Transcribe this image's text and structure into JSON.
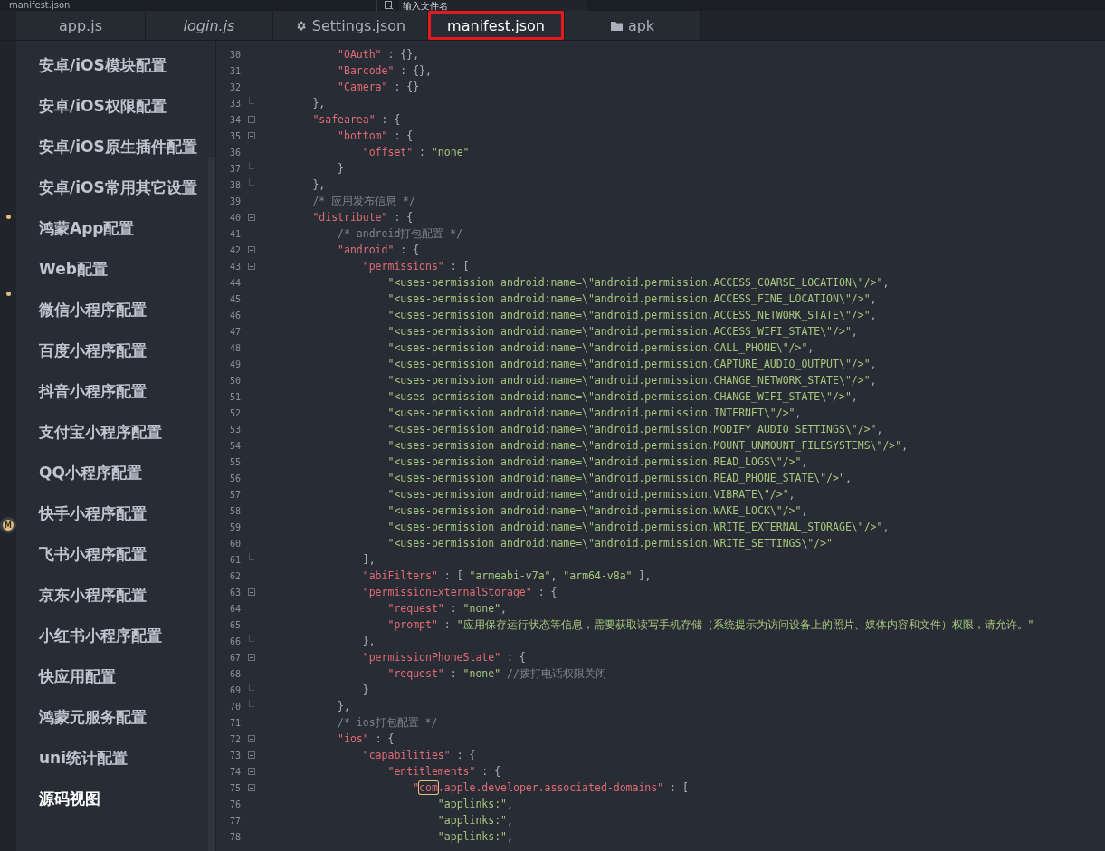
{
  "top_strip": {
    "title": "manifest.json",
    "search": {
      "placeholder": "输入文件名"
    }
  },
  "tabs": [
    {
      "label": "app.js",
      "kind": "file",
      "selected": false,
      "italic": false
    },
    {
      "label": "login.js",
      "kind": "file",
      "selected": false,
      "italic": true
    },
    {
      "label": "Settings.json",
      "kind": "settings",
      "selected": false,
      "italic": false
    },
    {
      "label": "manifest.json",
      "kind": "file",
      "selected": true,
      "italic": false,
      "framed": true
    },
    {
      "label": "apk",
      "kind": "folder",
      "selected": false,
      "italic": false
    }
  ],
  "gutter_markers": [
    {
      "kind": "dot"
    },
    {
      "kind": "dot"
    },
    {
      "kind": "badge",
      "text": "M"
    }
  ],
  "sidebar": {
    "items": [
      {
        "label": "安卓/iOS模块配置",
        "selected": false
      },
      {
        "label": "安卓/iOS权限配置",
        "selected": false
      },
      {
        "label": "安卓/iOS原生插件配置",
        "selected": false
      },
      {
        "label": "安卓/iOS常用其它设置",
        "selected": false
      },
      {
        "label": "鸿蒙App配置",
        "selected": false
      },
      {
        "label": "Web配置",
        "selected": false
      },
      {
        "label": "微信小程序配置",
        "selected": false
      },
      {
        "label": "百度小程序配置",
        "selected": false
      },
      {
        "label": "抖音小程序配置",
        "selected": false
      },
      {
        "label": "支付宝小程序配置",
        "selected": false
      },
      {
        "label": "QQ小程序配置",
        "selected": false
      },
      {
        "label": "快手小程序配置",
        "selected": false
      },
      {
        "label": "飞书小程序配置",
        "selected": false
      },
      {
        "label": "京东小程序配置",
        "selected": false
      },
      {
        "label": "小红书小程序配置",
        "selected": false
      },
      {
        "label": "快应用配置",
        "selected": false
      },
      {
        "label": "鸿蒙元服务配置",
        "selected": false
      },
      {
        "label": "uni统计配置",
        "selected": false
      },
      {
        "label": "源码视图",
        "selected": true
      }
    ]
  },
  "editor": {
    "lines": [
      {
        "n": "30",
        "kind": "plain",
        "tokens": [
          {
            "kind": "key",
            "t": "\"OAuth\""
          },
          {
            "kind": "punct",
            "t": " : {},"
          }
        ]
      },
      {
        "n": "31",
        "kind": "plain",
        "tokens": [
          {
            "kind": "key",
            "t": "\"Barcode\""
          },
          {
            "kind": "punct",
            "t": " : {},"
          }
        ]
      },
      {
        "n": "32",
        "kind": "plain",
        "tokens": [
          {
            "kind": "key",
            "t": "\"Camera\""
          },
          {
            "kind": "punct",
            "t": " : {}"
          }
        ]
      },
      {
        "n": "33",
        "kind": "closer",
        "tokens": [
          {
            "kind": "punct",
            "t": "},"
          }
        ]
      },
      {
        "n": "34",
        "kind": "opener",
        "tokens": [
          {
            "kind": "key",
            "t": "\"safearea\""
          },
          {
            "kind": "punct",
            "t": " : {"
          }
        ]
      },
      {
        "n": "35",
        "kind": "opener",
        "tokens": [
          {
            "kind": "key",
            "t": "\"bottom\""
          },
          {
            "kind": "punct",
            "t": " : {"
          }
        ]
      },
      {
        "n": "36",
        "kind": "plain",
        "tokens": [
          {
            "kind": "key",
            "t": "\"offset\""
          },
          {
            "kind": "punct",
            "t": " : "
          },
          {
            "kind": "string",
            "t": "\"none\""
          }
        ]
      },
      {
        "n": "37",
        "kind": "closer",
        "tokens": [
          {
            "kind": "punct",
            "t": "}"
          }
        ]
      },
      {
        "n": "38",
        "kind": "closer",
        "tokens": [
          {
            "kind": "punct",
            "t": "},"
          }
        ]
      },
      {
        "n": "39",
        "kind": "plain",
        "tokens": [
          {
            "kind": "comment",
            "t": "/* 应用发布信息 */"
          }
        ]
      },
      {
        "n": "40",
        "kind": "opener",
        "tokens": [
          {
            "kind": "key",
            "t": "\"distribute\""
          },
          {
            "kind": "punct",
            "t": " : {"
          }
        ]
      },
      {
        "n": "41",
        "kind": "plain",
        "tokens": [
          {
            "kind": "comment",
            "t": "/* android打包配置 */"
          }
        ]
      },
      {
        "n": "42",
        "kind": "opener",
        "tokens": [
          {
            "kind": "key",
            "t": "\"android\""
          },
          {
            "kind": "punct",
            "t": " : {"
          }
        ]
      },
      {
        "n": "43",
        "kind": "opener",
        "tokens": [
          {
            "kind": "key",
            "t": "\"permissions\""
          },
          {
            "kind": "punct",
            "t": " : ["
          }
        ]
      },
      {
        "n": "44",
        "kind": "plain",
        "tokens": [
          {
            "kind": "string",
            "t": "\"<uses-permission android:name=\\\"android.permission.ACCESS_COARSE_LOCATION\\\"/>\""
          },
          {
            "kind": "punct",
            "t": ","
          }
        ]
      },
      {
        "n": "45",
        "kind": "plain",
        "tokens": [
          {
            "kind": "string",
            "t": "\"<uses-permission android:name=\\\"android.permission.ACCESS_FINE_LOCATION\\\"/>\""
          },
          {
            "kind": "punct",
            "t": ","
          }
        ]
      },
      {
        "n": "46",
        "kind": "plain",
        "tokens": [
          {
            "kind": "string",
            "t": "\"<uses-permission android:name=\\\"android.permission.ACCESS_NETWORK_STATE\\\"/>\""
          },
          {
            "kind": "punct",
            "t": ","
          }
        ]
      },
      {
        "n": "47",
        "kind": "plain",
        "tokens": [
          {
            "kind": "string",
            "t": "\"<uses-permission android:name=\\\"android.permission.ACCESS_WIFI_STATE\\\"/>\""
          },
          {
            "kind": "punct",
            "t": ","
          }
        ]
      },
      {
        "n": "48",
        "kind": "plain",
        "tokens": [
          {
            "kind": "string",
            "t": "\"<uses-permission android:name=\\\"android.permission.CALL_PHONE\\\"/>\""
          },
          {
            "kind": "punct",
            "t": ","
          }
        ]
      },
      {
        "n": "49",
        "kind": "plain",
        "tokens": [
          {
            "kind": "string",
            "t": "\"<uses-permission android:name=\\\"android.permission.CAPTURE_AUDIO_OUTPUT\\\"/>\""
          },
          {
            "kind": "punct",
            "t": ","
          }
        ]
      },
      {
        "n": "50",
        "kind": "plain",
        "tokens": [
          {
            "kind": "string",
            "t": "\"<uses-permission android:name=\\\"android.permission.CHANGE_NETWORK_STATE\\\"/>\""
          },
          {
            "kind": "punct",
            "t": ","
          }
        ]
      },
      {
        "n": "51",
        "kind": "plain",
        "tokens": [
          {
            "kind": "string",
            "t": "\"<uses-permission android:name=\\\"android.permission.CHANGE_WIFI_STATE\\\"/>\""
          },
          {
            "kind": "punct",
            "t": ","
          }
        ]
      },
      {
        "n": "52",
        "kind": "plain",
        "tokens": [
          {
            "kind": "string",
            "t": "\"<uses-permission android:name=\\\"android.permission.INTERNET\\\"/>\""
          },
          {
            "kind": "punct",
            "t": ","
          }
        ]
      },
      {
        "n": "53",
        "kind": "plain",
        "tokens": [
          {
            "kind": "string",
            "t": "\"<uses-permission android:name=\\\"android.permission.MODIFY_AUDIO_SETTINGS\\\"/>\""
          },
          {
            "kind": "punct",
            "t": ","
          }
        ]
      },
      {
        "n": "54",
        "kind": "plain",
        "tokens": [
          {
            "kind": "string",
            "t": "\"<uses-permission android:name=\\\"android.permission.MOUNT_UNMOUNT_FILESYSTEMS\\\"/>\""
          },
          {
            "kind": "punct",
            "t": ","
          }
        ]
      },
      {
        "n": "55",
        "kind": "plain",
        "tokens": [
          {
            "kind": "string",
            "t": "\"<uses-permission android:name=\\\"android.permission.READ_LOGS\\\"/>\""
          },
          {
            "kind": "punct",
            "t": ","
          }
        ]
      },
      {
        "n": "56",
        "kind": "plain",
        "tokens": [
          {
            "kind": "string",
            "t": "\"<uses-permission android:name=\\\"android.permission.READ_PHONE_STATE\\\"/>\""
          },
          {
            "kind": "punct",
            "t": ","
          }
        ]
      },
      {
        "n": "57",
        "kind": "plain",
        "tokens": [
          {
            "kind": "string",
            "t": "\"<uses-permission android:name=\\\"android.permission.VIBRATE\\\"/>\""
          },
          {
            "kind": "punct",
            "t": ","
          }
        ]
      },
      {
        "n": "58",
        "kind": "plain",
        "tokens": [
          {
            "kind": "string",
            "t": "\"<uses-permission android:name=\\\"android.permission.WAKE_LOCK\\\"/>\""
          },
          {
            "kind": "punct",
            "t": ","
          }
        ]
      },
      {
        "n": "59",
        "kind": "plain",
        "tokens": [
          {
            "kind": "string",
            "t": "\"<uses-permission android:name=\\\"android.permission.WRITE_EXTERNAL_STORAGE\\\"/>\""
          },
          {
            "kind": "punct",
            "t": ","
          }
        ]
      },
      {
        "n": "60",
        "kind": "plain",
        "tokens": [
          {
            "kind": "string",
            "t": "\"<uses-permission android:name=\\\"android.permission.WRITE_SETTINGS\\\"/>\""
          }
        ]
      },
      {
        "n": "61",
        "kind": "closer",
        "tokens": [
          {
            "kind": "punct",
            "t": "],"
          }
        ]
      },
      {
        "n": "62",
        "kind": "plain",
        "tokens": [
          {
            "kind": "key",
            "t": "\"abiFilters\""
          },
          {
            "kind": "punct",
            "t": " : [ "
          },
          {
            "kind": "string",
            "t": "\"armeabi-v7a\""
          },
          {
            "kind": "punct",
            "t": ", "
          },
          {
            "kind": "string",
            "t": "\"arm64-v8a\""
          },
          {
            "kind": "punct",
            "t": " ],"
          }
        ]
      },
      {
        "n": "63",
        "kind": "opener",
        "tokens": [
          {
            "kind": "key",
            "t": "\"permissionExternalStorage\""
          },
          {
            "kind": "punct",
            "t": " : {"
          }
        ]
      },
      {
        "n": "64",
        "kind": "plain",
        "tokens": [
          {
            "kind": "key",
            "t": "\"request\""
          },
          {
            "kind": "punct",
            "t": " : "
          },
          {
            "kind": "string",
            "t": "\"none\""
          },
          {
            "kind": "punct",
            "t": ","
          }
        ]
      },
      {
        "n": "65",
        "kind": "plain",
        "tokens": [
          {
            "kind": "key",
            "t": "\"prompt\""
          },
          {
            "kind": "punct",
            "t": " : "
          },
          {
            "kind": "string",
            "t": "\"应用保存运行状态等信息，需要获取读写手机存储（系统提示为访问设备上的照片、媒体内容和文件）权限，请允许。\""
          }
        ]
      },
      {
        "n": "66",
        "kind": "closer",
        "tokens": [
          {
            "kind": "punct",
            "t": "},"
          }
        ]
      },
      {
        "n": "67",
        "kind": "opener",
        "tokens": [
          {
            "kind": "key",
            "t": "\"permissionPhoneState\""
          },
          {
            "kind": "punct",
            "t": " : {"
          }
        ]
      },
      {
        "n": "68",
        "kind": "plain",
        "tokens": [
          {
            "kind": "key",
            "t": "\"request\""
          },
          {
            "kind": "punct",
            "t": " : "
          },
          {
            "kind": "string",
            "t": "\"none\""
          },
          {
            "kind": "comment",
            "t": "//拨打电话权限关闭"
          }
        ]
      },
      {
        "n": "69",
        "kind": "closer",
        "tokens": [
          {
            "kind": "punct",
            "t": "}"
          }
        ]
      },
      {
        "n": "70",
        "kind": "closer",
        "tokens": [
          {
            "kind": "punct",
            "t": "},"
          }
        ]
      },
      {
        "n": "71",
        "kind": "plain",
        "tokens": [
          {
            "kind": "comment",
            "t": "/* ios打包配置 */"
          }
        ]
      },
      {
        "n": "72",
        "kind": "opener",
        "tokens": [
          {
            "kind": "key",
            "t": "\"ios\""
          },
          {
            "kind": "punct",
            "t": " : {"
          }
        ]
      },
      {
        "n": "73",
        "kind": "opener",
        "tokens": [
          {
            "kind": "key",
            "t": "\"capabilities\""
          },
          {
            "kind": "punct",
            "t": " : {"
          }
        ]
      },
      {
        "n": "74",
        "kind": "opener",
        "tokens": [
          {
            "kind": "key",
            "t": "\"entitlements\""
          },
          {
            "kind": "punct",
            "t": " : {"
          }
        ]
      },
      {
        "n": "75",
        "kind": "opener",
        "tokens": [
          {
            "kind": "key",
            "t": "\""
          },
          {
            "kind": "key",
            "t": "com",
            "boxed": true
          },
          {
            "kind": "key",
            "t": ".apple.developer.associated-domains\""
          },
          {
            "kind": "punct",
            "t": " : ["
          }
        ]
      },
      {
        "n": "76",
        "kind": "plain",
        "tokens": [
          {
            "kind": "string",
            "t": "\"applinks:\""
          },
          {
            "kind": "punct",
            "t": ","
          }
        ]
      },
      {
        "n": "77",
        "kind": "plain",
        "tokens": [
          {
            "kind": "string",
            "t": "\"applinks:\""
          },
          {
            "kind": "punct",
            "t": ","
          }
        ]
      },
      {
        "n": "78",
        "kind": "plain",
        "tokens": [
          {
            "kind": "string",
            "t": "\"applinks:\""
          },
          {
            "kind": "punct",
            "t": ","
          }
        ]
      }
    ]
  }
}
